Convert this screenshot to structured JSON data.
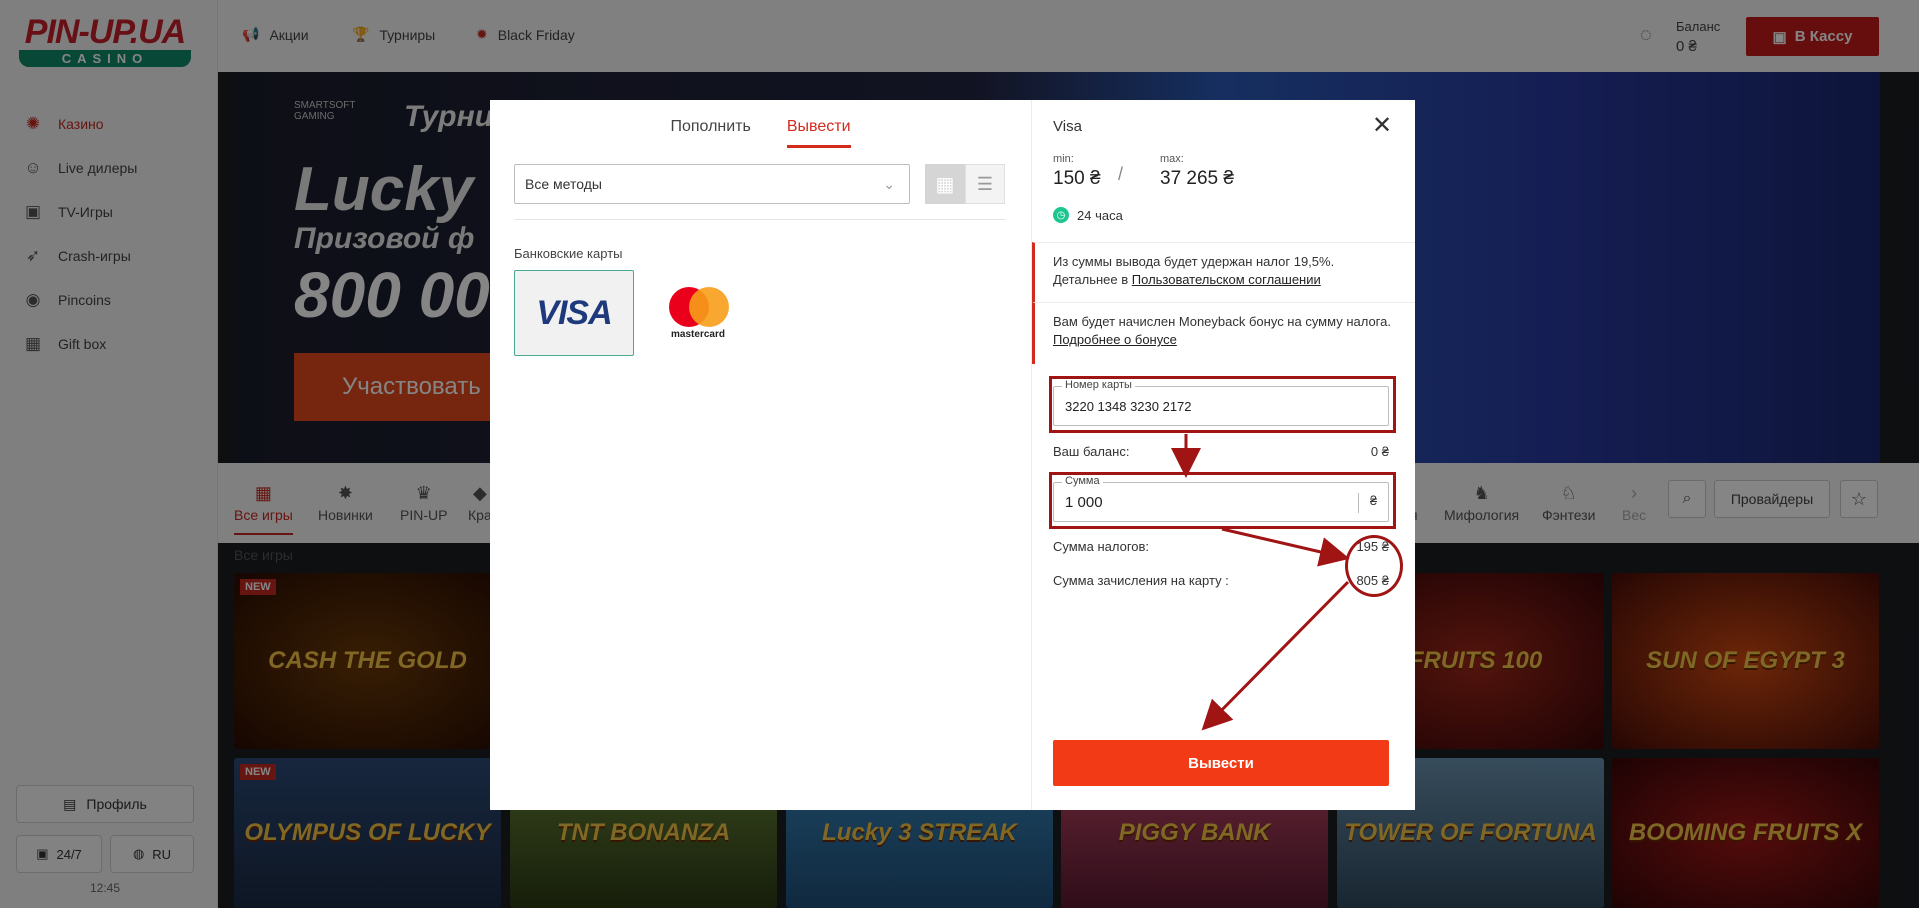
{
  "brand": {
    "logo_main": "PIN-UP.UA",
    "logo_sub": "CASINO"
  },
  "sidebar": {
    "items": [
      {
        "label": "Казино",
        "icon": "casino-icon"
      },
      {
        "label": "Live дилеры",
        "icon": "live-dealer-icon"
      },
      {
        "label": "TV-Игры",
        "icon": "tv-icon"
      },
      {
        "label": "Crash-игры",
        "icon": "rocket-icon"
      },
      {
        "label": "Pincoins",
        "icon": "coin-icon"
      },
      {
        "label": "Gift box",
        "icon": "gift-icon"
      }
    ],
    "profile_label": "Профиль",
    "support_label": "24/7",
    "lang_label": "RU",
    "time": "12:45"
  },
  "header": {
    "links": [
      "Акции",
      "Турниры",
      "Black Friday"
    ],
    "balance_label": "Баланс",
    "balance_value": "0 ₴",
    "cashier_label": "В Кассу"
  },
  "banner": {
    "partner": "SMARTSOFT GAMING",
    "title_top": "Турни",
    "title": "Lucky",
    "subtitle": "Призовой ф",
    "amount": "800 00",
    "cta": "Участвовать"
  },
  "categories": {
    "items": [
      "Все игры",
      "Новинки",
      "PIN-UP",
      "Кра",
      "я",
      "Мифология",
      "Фэнтези",
      "Вес"
    ],
    "providers_label": "Провайдеры"
  },
  "games": {
    "section_title": "Все игры",
    "badge": "NEW",
    "titles": [
      "CASH THE GOLD",
      "FRUITS 100",
      "SUN OF EGYPT 3",
      "OLYMPUS OF LUCKY",
      "TNT BONANZA",
      "Lucky 3 STREAK",
      "PIGGY BANK",
      "TOWER OF FORTUNA",
      "BOOMING FRUITS X"
    ]
  },
  "modal": {
    "tabs": [
      "Пополнить",
      "Вывести"
    ],
    "active_tab": "Вывести",
    "methods_select": "Все методы",
    "bank_cards_title": "Банковские карты",
    "cards": [
      "VISA",
      "mastercard"
    ],
    "right": {
      "title": "Visa",
      "min_label": "min:",
      "min_value": "150 ₴",
      "max_label": "max:",
      "max_value": "37 265 ₴",
      "time": "24 часа",
      "tax_notice": "Из суммы вывода будет удержан налог 19,5%.",
      "tax_more_prefix": "Детальнее в ",
      "tax_more_link": "Пользовательском соглашении",
      "bonus_notice": "Вам будет начислен Moneyback бонус на сумму налога. ",
      "bonus_link": "Подробнее о бонусе",
      "card_label": "Номер карты",
      "card_value": "3220 1348 3230 2172",
      "your_balance_label": "Ваш баланс:",
      "your_balance_value": "0 ₴",
      "amount_label": "Сумма",
      "amount_value": "1 000",
      "currency": "₴",
      "tax_sum_label": "Сумма налогов:",
      "tax_sum_value": "195 ₴",
      "credit_label": "Сумма зачисления на карту :",
      "credit_value": "805 ₴",
      "submit": "Вывести"
    }
  },
  "colors": {
    "accent": "#d22b1e",
    "submit": "#f23a16",
    "annotation": "#a01414",
    "timer": "#1ec68f"
  }
}
